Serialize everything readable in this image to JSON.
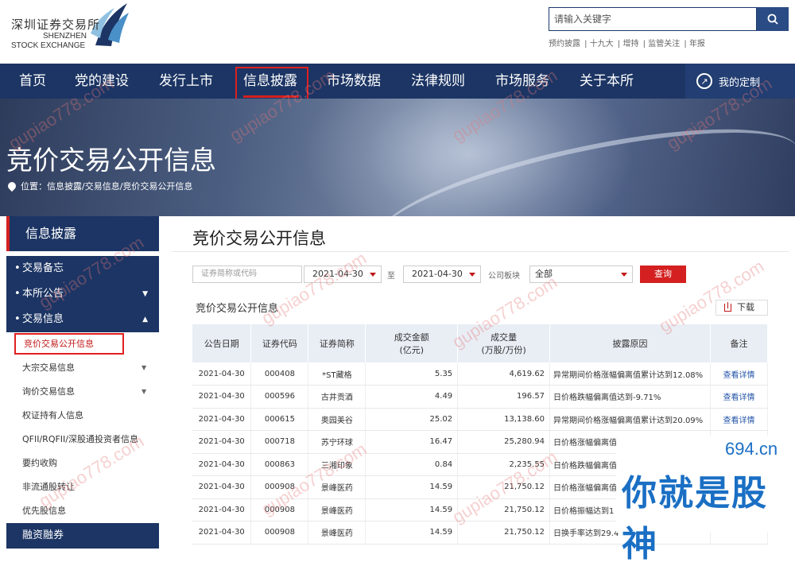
{
  "header": {
    "logo_cn": "深圳证券交易所",
    "logo_en_1": "SHENZHEN",
    "logo_en_2": "STOCK EXCHANGE",
    "search_placeholder": "请输入关键字",
    "quick_links": [
      "预约披露",
      "十九大",
      "增持",
      "监管关注",
      "年报"
    ]
  },
  "nav": {
    "items": [
      "首页",
      "党的建设",
      "发行上市",
      "信息披露",
      "市场数据",
      "法律规则",
      "市场服务",
      "关于本所"
    ],
    "active": "信息披露",
    "custom_label": "我的定制"
  },
  "banner": {
    "title": "竞价交易公开信息",
    "breadcrumb": "位置：信息披露/交易信息/竞价交易公开信息"
  },
  "sidebar": {
    "heading": "信息披露",
    "main_items": [
      "交易备忘",
      "本所公告",
      "交易信息"
    ],
    "sub_items": [
      "竞价交易公开信息",
      "大宗交易信息",
      "询价交易信息",
      "权证持有人信息",
      "QFII/RQFII/深股通投资者信息",
      "要约收购",
      "非流通股转让",
      "优先股信息"
    ],
    "bottom_item": "融资融券"
  },
  "content": {
    "title": "竞价交易公开信息",
    "filter": {
      "code_placeholder": "证券简称或代码",
      "date_from": "2021-04-30",
      "to_label": "至",
      "date_to": "2021-04-30",
      "board_label": "公司板块",
      "board_value": "全部",
      "query_label": "查询"
    },
    "table_caption": "竞价交易公开信息",
    "download_label": "下载",
    "columns": [
      "公告日期",
      "证券代码",
      "证券简称",
      "成交金额\n(亿元)",
      "成交量\n(万股/万份)",
      "披露原因",
      "备注"
    ],
    "rows": [
      {
        "date": "2021-04-30",
        "code": "000408",
        "name": "*ST藏格",
        "amount": "5.35",
        "volume": "4,619.62",
        "reason": "异常期间价格涨幅偏离值累计达到12.08%",
        "note": "查看详情"
      },
      {
        "date": "2021-04-30",
        "code": "000596",
        "name": "古井贡酒",
        "amount": "4.49",
        "volume": "196.57",
        "reason": "日价格跌幅偏离值达到-9.71%",
        "note": "查看详情"
      },
      {
        "date": "2021-04-30",
        "code": "000615",
        "name": "奥园美谷",
        "amount": "25.02",
        "volume": "13,138.60",
        "reason": "异常期间价格涨幅偏离值累计达到20.09%",
        "note": "查看详情"
      },
      {
        "date": "2021-04-30",
        "code": "000718",
        "name": "苏宁环球",
        "amount": "16.47",
        "volume": "25,280.94",
        "reason": "日价格涨幅偏离值",
        "note": ""
      },
      {
        "date": "2021-04-30",
        "code": "000863",
        "name": "三湘印象",
        "amount": "0.84",
        "volume": "2,235.55",
        "reason": "日价格跌幅偏离值",
        "note": ""
      },
      {
        "date": "2021-04-30",
        "code": "000908",
        "name": "景峰医药",
        "amount": "14.59",
        "volume": "21,750.12",
        "reason": "日价格涨幅偏离值",
        "note": ""
      },
      {
        "date": "2021-04-30",
        "code": "000908",
        "name": "景峰医药",
        "amount": "14.59",
        "volume": "21,750.12",
        "reason": "日价格振幅达到1",
        "note": ""
      },
      {
        "date": "2021-04-30",
        "code": "000908",
        "name": "景峰医药",
        "amount": "14.59",
        "volume": "21,750.12",
        "reason": "日换手率达到29.4",
        "note": ""
      }
    ]
  },
  "watermark": "gupiao778.com",
  "ad": {
    "domain": "694.cn",
    "slogan": "你就是股神"
  }
}
